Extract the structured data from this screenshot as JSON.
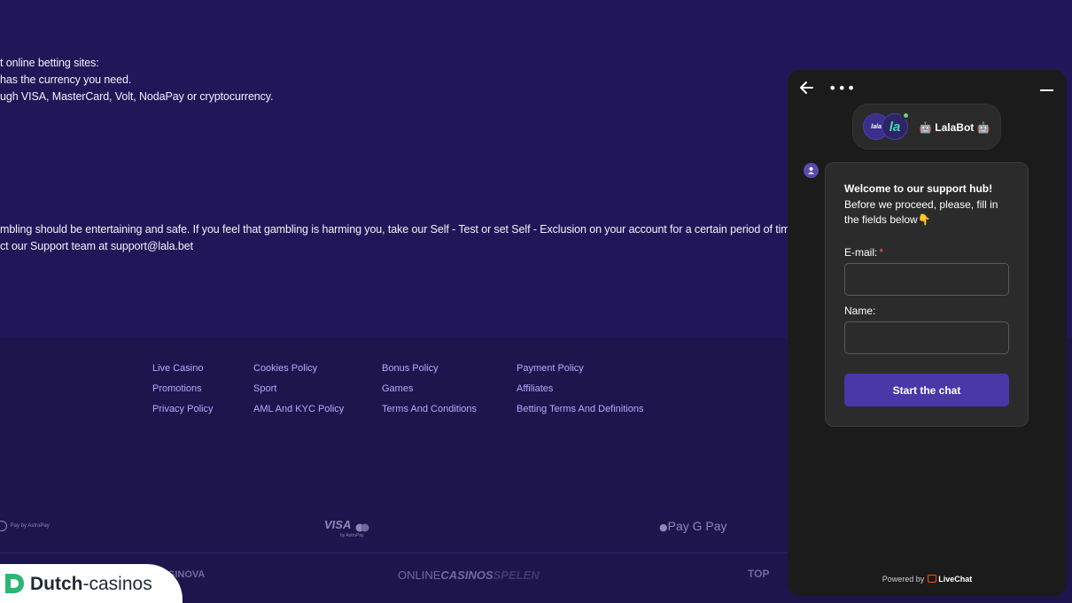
{
  "content": {
    "lines": [
      "t online betting sites:",
      "has the currency you need.",
      "ugh VISA, MasterCard, Volt, NodaPay or cryptocurrency.",
      "mbling should be entertaining and safe. If you feel that gambling is harming you, take our Self - Test or set Self - Exclusion on your account for a certain period of time.",
      "ct our Support team at support@lala.bet"
    ]
  },
  "footer": {
    "links": [
      [
        "Live Casino",
        "Promotions",
        "Privacy Policy"
      ],
      [
        "Cookies Policy",
        "Sport",
        "AML And KYC Policy"
      ],
      [
        "Bonus Policy",
        "Games",
        "Terms And Conditions"
      ],
      [
        "Payment Policy",
        "Affiliates",
        "Betting Terms And Definitions"
      ]
    ],
    "payments": {
      "astropay": "Pay by AstroPay",
      "visa": "VISA",
      "visa_sub": "by AstroPay",
      "wallets": "Pay G Pay"
    },
    "partners": {
      "sinova": "SINOVA",
      "online_casinos": "ONLINE",
      "online_casinos_bold": "CASINOS",
      "online_casinos_tail": "SPELEN",
      "top": "TOP"
    }
  },
  "chat": {
    "more": "•••",
    "bot_name": "LalaBot",
    "avatar_text": "lala",
    "avatar_text_b": "la",
    "welcome_title": "Welcome to our support hub!",
    "welcome_text": "Before we proceed, please, fill in the fields below👇",
    "email_label": "E-mail:",
    "email_required": "*",
    "name_label": "Name:",
    "start_button": "Start the chat",
    "powered_prefix": "Powered by",
    "powered_brand": "LiveChat"
  },
  "badge": {
    "brand_bold": "Dutch",
    "brand_rest": "-casinos"
  },
  "colors": {
    "background": "#211758",
    "footer_link": "#b9a8ff",
    "chat_bg": "#1b1b1b",
    "button": "#4a38a8"
  }
}
